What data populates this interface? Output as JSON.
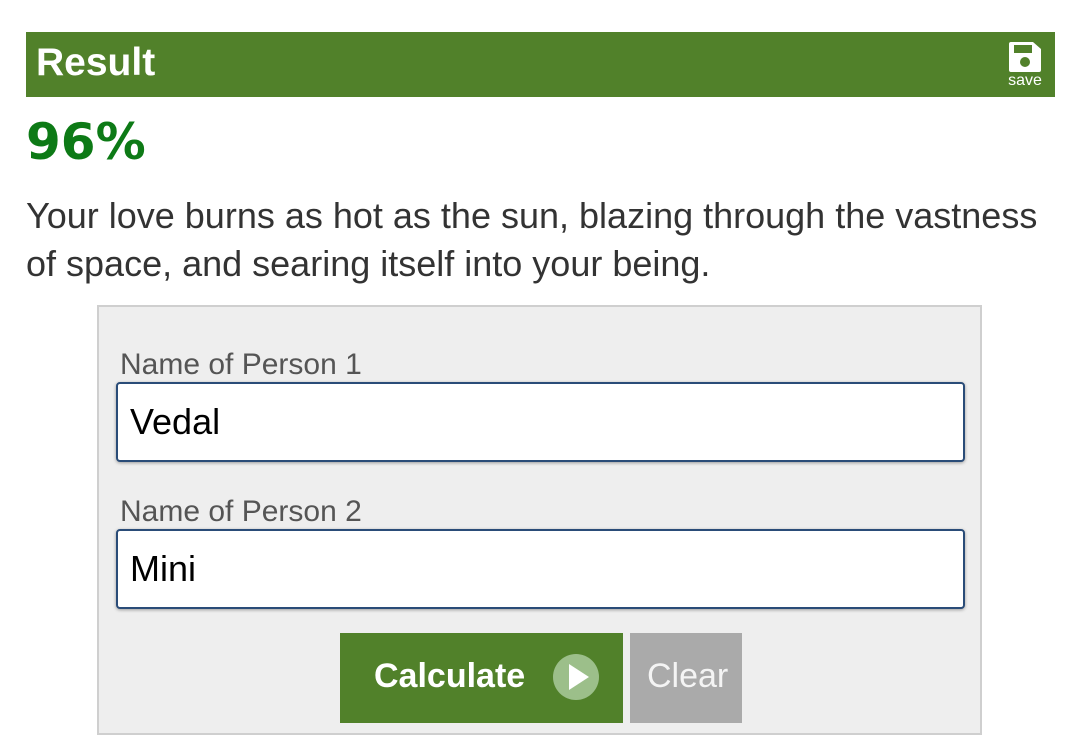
{
  "result": {
    "title": "Result",
    "save_label": "save",
    "save_icon": "floppy-disk-icon",
    "percentage": "96%",
    "message": "Your love burns as hot as the sun, blazing through the vastness of space, and searing itself into your being."
  },
  "form": {
    "person1_label": "Name of Person 1",
    "person1_value": "Vedal",
    "person2_label": "Name of Person 2",
    "person2_value": "Mini",
    "calculate_label": "Calculate",
    "calculate_icon": "play-icon",
    "clear_label": "Clear"
  },
  "colors": {
    "header_green": "#51812a",
    "percent_green": "#0d7a16",
    "input_border": "#2a4c78",
    "clear_gray": "#aaaaaa"
  }
}
